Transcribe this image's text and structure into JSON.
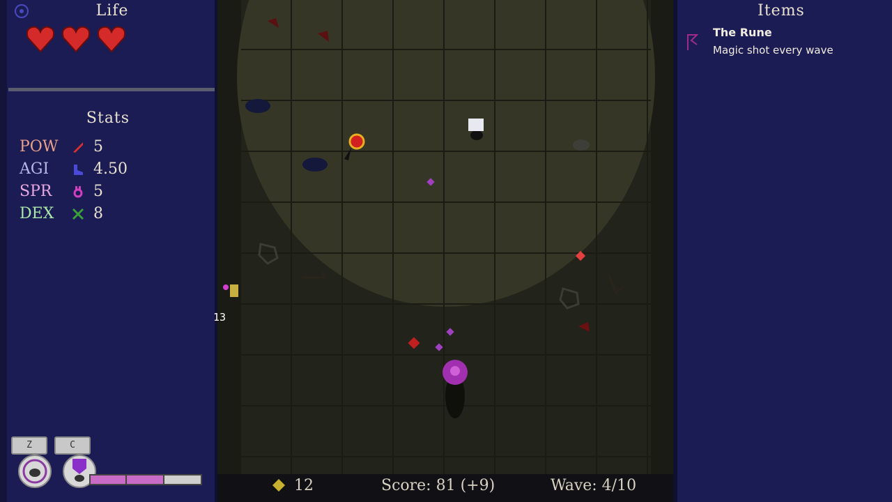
{
  "life": {
    "title": "Life",
    "hearts": 3,
    "heart_color": "#d42a2a"
  },
  "stats": {
    "title": "Stats",
    "rows": [
      {
        "name": "POW",
        "value": "5",
        "icon": "sword-icon",
        "name_color": "#e8a08a",
        "icon_color": "#d83030"
      },
      {
        "name": "AGI",
        "value": "4.50",
        "icon": "boot-icon",
        "name_color": "#b8b8e8",
        "icon_color": "#4a4ad8"
      },
      {
        "name": "SPR",
        "value": "5",
        "icon": "spirit-icon",
        "name_color": "#e8a8e0",
        "icon_color": "#d040c0"
      },
      {
        "name": "DEX",
        "value": "8",
        "icon": "crossed-swords-icon",
        "name_color": "#a8e8a8",
        "icon_color": "#3aa03a"
      }
    ]
  },
  "abilities": {
    "key_z": "Z",
    "key_c": "C",
    "mana_fraction": 0.66,
    "mana_color": "#c86cc8"
  },
  "hud": {
    "coins": "12",
    "score": "Score: 81 (+9)",
    "wave": "Wave: 4/10",
    "damage_number": "13"
  },
  "items": {
    "title": "Items",
    "list": [
      {
        "name": "The Rune",
        "description": "Magic shot every wave",
        "icon": "rune-icon"
      }
    ]
  },
  "colors": {
    "panel": "#1c1c55",
    "floor": "#22231a",
    "light": "#3a3b2c"
  }
}
